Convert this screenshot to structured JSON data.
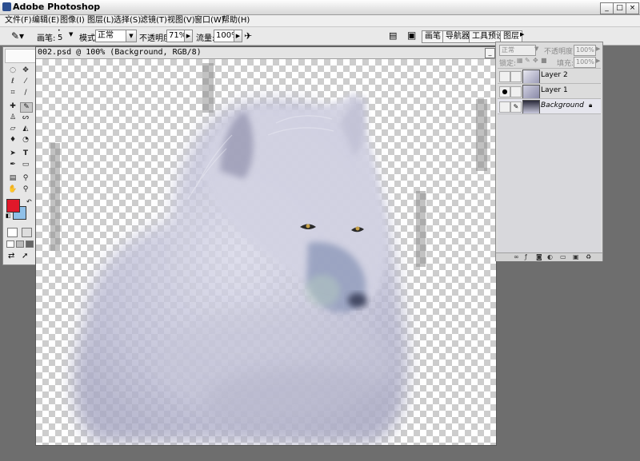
{
  "app": {
    "title": "Adobe Photoshop"
  },
  "window_controls": {
    "minimize": "_",
    "maximize": "□",
    "close": "×"
  },
  "menu": [
    "文件(F)",
    "编辑(E)",
    "图像(I)",
    "图层(L)",
    "选择(S)",
    "滤镜(T)",
    "视图(V)",
    "窗口(W)",
    "帮助(H)"
  ],
  "options": {
    "brush_label": "画笔:",
    "brush_size": "5",
    "mode_label": "模式:",
    "mode_value": "正常",
    "opacity_label": "不透明度:",
    "opacity_value": "71%",
    "flow_label": "流量:",
    "flow_value": "100%"
  },
  "palette_well": [
    "画笔",
    "导航器",
    "工具预设",
    "图层"
  ],
  "document": {
    "title": "002.psd @ 100% (Background, RGB/8)",
    "zoom": "100%"
  },
  "layers_panel": {
    "blend_mode": "正常",
    "opacity_label": "不透明度:",
    "opacity_value": "100%",
    "lock_label": "锁定:",
    "fill_label": "填充:",
    "fill_value": "100%",
    "layers": [
      {
        "name": "Layer 2",
        "visible": false
      },
      {
        "name": "Layer 1",
        "visible": true
      },
      {
        "name": "Background",
        "visible": false,
        "locked": true
      }
    ]
  },
  "colors": {
    "foreground": "#e0182a",
    "background": "#8fc0e8",
    "wolf_tone": "#c9c9dc"
  },
  "icons": {
    "tools": [
      "marquee-icon",
      "move-icon",
      "lasso-icon",
      "magic-wand-icon",
      "crop-icon",
      "slice-icon",
      "healing-icon",
      "brush-icon",
      "stamp-icon",
      "history-brush-icon",
      "eraser-icon",
      "bucket-icon",
      "blur-icon",
      "dodge-icon",
      "path-select-icon",
      "type-icon",
      "pen-icon",
      "shape-icon",
      "notes-icon",
      "eyedropper-icon",
      "hand-icon",
      "zoom-icon"
    ]
  }
}
